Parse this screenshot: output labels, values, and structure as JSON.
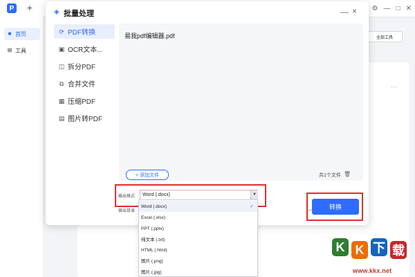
{
  "app": {
    "logo_letter": "P",
    "new_tab_label": "+",
    "window_controls": [
      "⚙",
      "—",
      "□",
      "✕"
    ]
  },
  "sidebar": {
    "items": [
      {
        "label": "首页",
        "icon": "home-icon"
      },
      {
        "label": "工具",
        "icon": "grid-icon"
      }
    ]
  },
  "background": {
    "all_tools_label": "全部工具",
    "more_label": "···"
  },
  "modal": {
    "title": "批量处理",
    "title_icon": "layers-icon",
    "nav": [
      {
        "label": "PDF转换",
        "icon": "refresh-icon"
      },
      {
        "label": "OCR文本...",
        "icon": "scan-icon"
      },
      {
        "label": "拆分PDF",
        "icon": "split-icon"
      },
      {
        "label": "合并文件",
        "icon": "merge-icon"
      },
      {
        "label": "压缩PDF",
        "icon": "compress-icon"
      },
      {
        "label": "图片转PDF",
        "icon": "image-icon"
      }
    ],
    "file_list": [
      "易我pdf编辑器.pdf"
    ],
    "add_file_label": "+ 添加文件",
    "file_count_label": "共1个文件",
    "format_label": "输出格式",
    "format_value": "Word (.docx)",
    "output_dir_label": "输出目录",
    "convert_label": "转换"
  },
  "dropdown": {
    "options": [
      "Word (.docx)",
      "Excel (.xlsx)",
      "PPT (.pptx)",
      "纯文本 (.txt)",
      "HTML (.html)",
      "图片 (.png)",
      "图片 (.jpg)"
    ],
    "selected_index": 0
  },
  "watermark": {
    "chars": [
      "K",
      "K",
      "下",
      "载"
    ],
    "url": "www.kkx.net"
  },
  "colors": {
    "accent": "#2f6bff",
    "highlight": "#e02d2d"
  }
}
